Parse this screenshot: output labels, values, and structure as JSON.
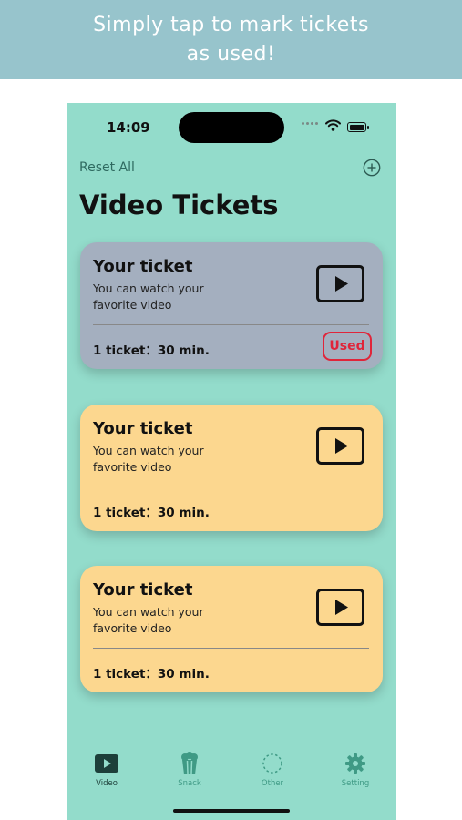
{
  "banner": {
    "line1": "Simply tap to mark tickets",
    "line2": "as used!"
  },
  "status_bar": {
    "time": "14:09"
  },
  "header": {
    "reset_label": "Reset All",
    "add_icon": "plus-circle-icon",
    "title": "Video Tickets"
  },
  "tickets": [
    {
      "title": "Your ticket",
      "description": "You can watch your favorite video",
      "info": "1 ticket：30 min.",
      "icon": "play-icon",
      "used": true,
      "used_label": "Used"
    },
    {
      "title": "Your ticket",
      "description": "You can watch your favorite video",
      "info": "1 ticket：30 min.",
      "icon": "play-icon",
      "used": false
    },
    {
      "title": "Your ticket",
      "description": "You can watch your favorite video",
      "info": "1 ticket：30 min.",
      "icon": "play-icon",
      "used": false
    }
  ],
  "tabs": [
    {
      "label": "Video",
      "icon": "video-icon",
      "active": true
    },
    {
      "label": "Snack",
      "icon": "popcorn-icon",
      "active": false
    },
    {
      "label": "Other",
      "icon": "dashed-circle-icon",
      "active": false
    },
    {
      "label": "Setting",
      "icon": "gear-icon",
      "active": false
    }
  ],
  "colors": {
    "banner": "#97c4cc",
    "background": "#93dccb",
    "used_card": "#a4afbf",
    "unused_card": "#fcd78f",
    "used_badge": "#e0253a",
    "tab_active": "#1d3f3a",
    "tab_inactive": "#3f9a85"
  }
}
